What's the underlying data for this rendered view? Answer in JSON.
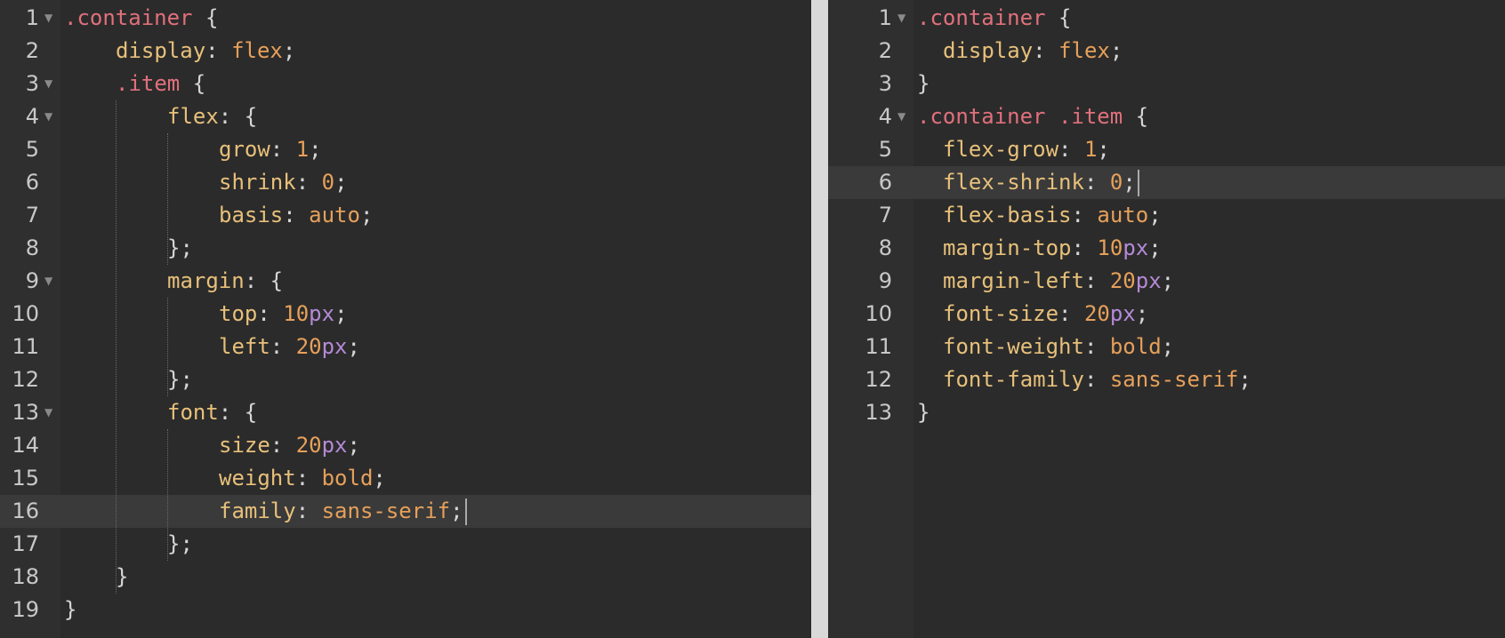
{
  "left_editor": {
    "lines": [
      {
        "n": "1",
        "fold": true,
        "indent": 0,
        "tokens": [
          [
            "sel",
            ".container"
          ],
          [
            "punc",
            " {"
          ]
        ]
      },
      {
        "n": "2",
        "fold": false,
        "indent": 1,
        "tokens": [
          [
            "prop",
            "display"
          ],
          [
            "punc",
            ": "
          ],
          [
            "kw",
            "flex"
          ],
          [
            "punc",
            ";"
          ]
        ]
      },
      {
        "n": "3",
        "fold": true,
        "indent": 1,
        "tokens": [
          [
            "sel",
            ".item"
          ],
          [
            "punc",
            " {"
          ]
        ]
      },
      {
        "n": "4",
        "fold": true,
        "indent": 2,
        "tokens": [
          [
            "prop",
            "flex"
          ],
          [
            "punc",
            ": {"
          ]
        ]
      },
      {
        "n": "5",
        "fold": false,
        "indent": 3,
        "tokens": [
          [
            "prop",
            "grow"
          ],
          [
            "punc",
            ": "
          ],
          [
            "num",
            "1"
          ],
          [
            "punc",
            ";"
          ]
        ]
      },
      {
        "n": "6",
        "fold": false,
        "indent": 3,
        "tokens": [
          [
            "prop",
            "shrink"
          ],
          [
            "punc",
            ": "
          ],
          [
            "num",
            "0"
          ],
          [
            "punc",
            ";"
          ]
        ]
      },
      {
        "n": "7",
        "fold": false,
        "indent": 3,
        "tokens": [
          [
            "prop",
            "basis"
          ],
          [
            "punc",
            ": "
          ],
          [
            "kw",
            "auto"
          ],
          [
            "punc",
            ";"
          ]
        ]
      },
      {
        "n": "8",
        "fold": false,
        "indent": 2,
        "tokens": [
          [
            "punc",
            "};"
          ]
        ]
      },
      {
        "n": "9",
        "fold": true,
        "indent": 2,
        "tokens": [
          [
            "prop",
            "margin"
          ],
          [
            "punc",
            ": {"
          ]
        ]
      },
      {
        "n": "10",
        "fold": false,
        "indent": 3,
        "tokens": [
          [
            "prop",
            "top"
          ],
          [
            "punc",
            ": "
          ],
          [
            "num",
            "10"
          ],
          [
            "unit",
            "px"
          ],
          [
            "punc",
            ";"
          ]
        ]
      },
      {
        "n": "11",
        "fold": false,
        "indent": 3,
        "tokens": [
          [
            "prop",
            "left"
          ],
          [
            "punc",
            ": "
          ],
          [
            "num",
            "20"
          ],
          [
            "unit",
            "px"
          ],
          [
            "punc",
            ";"
          ]
        ]
      },
      {
        "n": "12",
        "fold": false,
        "indent": 2,
        "tokens": [
          [
            "punc",
            "};"
          ]
        ]
      },
      {
        "n": "13",
        "fold": true,
        "indent": 2,
        "tokens": [
          [
            "prop",
            "font"
          ],
          [
            "punc",
            ": {"
          ]
        ]
      },
      {
        "n": "14",
        "fold": false,
        "indent": 3,
        "tokens": [
          [
            "prop",
            "size"
          ],
          [
            "punc",
            ": "
          ],
          [
            "num",
            "20"
          ],
          [
            "unit",
            "px"
          ],
          [
            "punc",
            ";"
          ]
        ]
      },
      {
        "n": "15",
        "fold": false,
        "indent": 3,
        "tokens": [
          [
            "prop",
            "weight"
          ],
          [
            "punc",
            ": "
          ],
          [
            "kw",
            "bold"
          ],
          [
            "punc",
            ";"
          ]
        ]
      },
      {
        "n": "16",
        "fold": false,
        "indent": 3,
        "active": true,
        "caret": true,
        "tokens": [
          [
            "prop",
            "family"
          ],
          [
            "punc",
            ": "
          ],
          [
            "kw",
            "sans-serif"
          ],
          [
            "punc",
            ";"
          ]
        ]
      },
      {
        "n": "17",
        "fold": false,
        "indent": 2,
        "tokens": [
          [
            "punc",
            "};"
          ]
        ]
      },
      {
        "n": "18",
        "fold": false,
        "indent": 1,
        "tokens": [
          [
            "punc",
            "}"
          ]
        ]
      },
      {
        "n": "19",
        "fold": false,
        "indent": 0,
        "tokens": [
          [
            "punc",
            "}"
          ]
        ]
      }
    ]
  },
  "right_editor": {
    "lines": [
      {
        "n": "1",
        "fold": true,
        "indent": 0,
        "tokens": [
          [
            "sel",
            ".container"
          ],
          [
            "punc",
            " {"
          ]
        ]
      },
      {
        "n": "2",
        "fold": false,
        "indent": 1,
        "tokens": [
          [
            "prop",
            "display"
          ],
          [
            "punc",
            ": "
          ],
          [
            "kw",
            "flex"
          ],
          [
            "punc",
            ";"
          ]
        ]
      },
      {
        "n": "3",
        "fold": false,
        "indent": 0,
        "tokens": [
          [
            "punc",
            "}"
          ]
        ]
      },
      {
        "n": "4",
        "fold": true,
        "indent": 0,
        "tokens": [
          [
            "sel",
            ".container .item"
          ],
          [
            "punc",
            " {"
          ]
        ]
      },
      {
        "n": "5",
        "fold": false,
        "indent": 1,
        "tokens": [
          [
            "prop",
            "flex-grow"
          ],
          [
            "punc",
            ": "
          ],
          [
            "num",
            "1"
          ],
          [
            "punc",
            ";"
          ]
        ]
      },
      {
        "n": "6",
        "fold": false,
        "indent": 1,
        "active": true,
        "caret": true,
        "tokens": [
          [
            "prop",
            "flex-shrink"
          ],
          [
            "punc",
            ": "
          ],
          [
            "num",
            "0"
          ],
          [
            "punc",
            ";"
          ]
        ]
      },
      {
        "n": "7",
        "fold": false,
        "indent": 1,
        "tokens": [
          [
            "prop",
            "flex-basis"
          ],
          [
            "punc",
            ": "
          ],
          [
            "kw",
            "auto"
          ],
          [
            "punc",
            ";"
          ]
        ]
      },
      {
        "n": "8",
        "fold": false,
        "indent": 1,
        "tokens": [
          [
            "prop",
            "margin-top"
          ],
          [
            "punc",
            ": "
          ],
          [
            "num",
            "10"
          ],
          [
            "unit",
            "px"
          ],
          [
            "punc",
            ";"
          ]
        ]
      },
      {
        "n": "9",
        "fold": false,
        "indent": 1,
        "tokens": [
          [
            "prop",
            "margin-left"
          ],
          [
            "punc",
            ": "
          ],
          [
            "num",
            "20"
          ],
          [
            "unit",
            "px"
          ],
          [
            "punc",
            ";"
          ]
        ]
      },
      {
        "n": "10",
        "fold": false,
        "indent": 1,
        "tokens": [
          [
            "prop",
            "font-size"
          ],
          [
            "punc",
            ": "
          ],
          [
            "num",
            "20"
          ],
          [
            "unit",
            "px"
          ],
          [
            "punc",
            ";"
          ]
        ]
      },
      {
        "n": "11",
        "fold": false,
        "indent": 1,
        "tokens": [
          [
            "prop",
            "font-weight"
          ],
          [
            "punc",
            ": "
          ],
          [
            "kw",
            "bold"
          ],
          [
            "punc",
            ";"
          ]
        ]
      },
      {
        "n": "12",
        "fold": false,
        "indent": 1,
        "tokens": [
          [
            "prop",
            "font-family"
          ],
          [
            "punc",
            ": "
          ],
          [
            "kw",
            "sans-serif"
          ],
          [
            "punc",
            ";"
          ]
        ]
      },
      {
        "n": "13",
        "fold": false,
        "indent": 0,
        "tokens": [
          [
            "punc",
            "}"
          ]
        ]
      }
    ]
  },
  "icons": {
    "fold": "fold-arrow-icon",
    "cursor": "mouse-pointer-icon"
  },
  "colors": {
    "editor_bg": "#2b2b2b",
    "active_line": "#3a3a3a",
    "selector": "#e1707c",
    "property": "#e7c07a",
    "number": "#e6a05a",
    "unit": "#b48ad6",
    "punctuation": "#d6d6d6"
  }
}
